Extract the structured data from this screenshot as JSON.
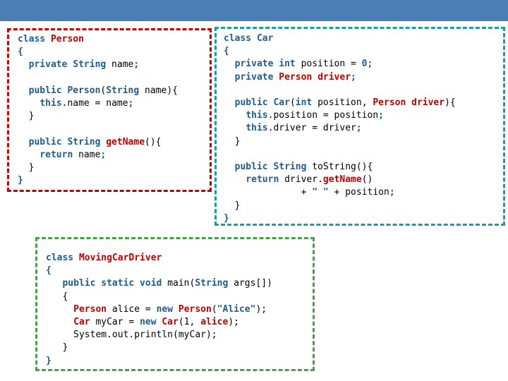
{
  "slide": {
    "background_color": "#ffffff",
    "top_bar_color": "#4a7eb5"
  },
  "code_blocks": [
    {
      "name": "person-class",
      "border_color": "#c00000",
      "lines": [
        "class Person",
        "{",
        "  private String name;",
        "",
        "  public Person(String name){",
        "    this.name = name;",
        "  }",
        "",
        "  public String getName(){",
        "    return name;",
        "  }",
        "}"
      ]
    },
    {
      "name": "car-class",
      "border_color": "#1f9aa0",
      "lines": [
        "class Car",
        "{",
        "  private int position = 0;",
        "  private Person driver;",
        "",
        "  public Car(int position, Person driver){",
        "    this.position = position;",
        "    this.driver = driver;",
        "  }",
        "",
        "  public String toString(){",
        "    return driver.getName()",
        "              + \" \" + position;",
        "  }",
        "}"
      ]
    },
    {
      "name": "moving-car-driver-class",
      "border_color": "#4aa04a",
      "lines": [
        "class MovingCarDriver",
        "{",
        "  public static void main(String args[])",
        "  {",
        "    Person alice = new Person(\"Alice\");",
        "    Car myCar = new Car(1, alice);",
        "    System.out.println(myCar);",
        "  }",
        "}"
      ]
    }
  ]
}
